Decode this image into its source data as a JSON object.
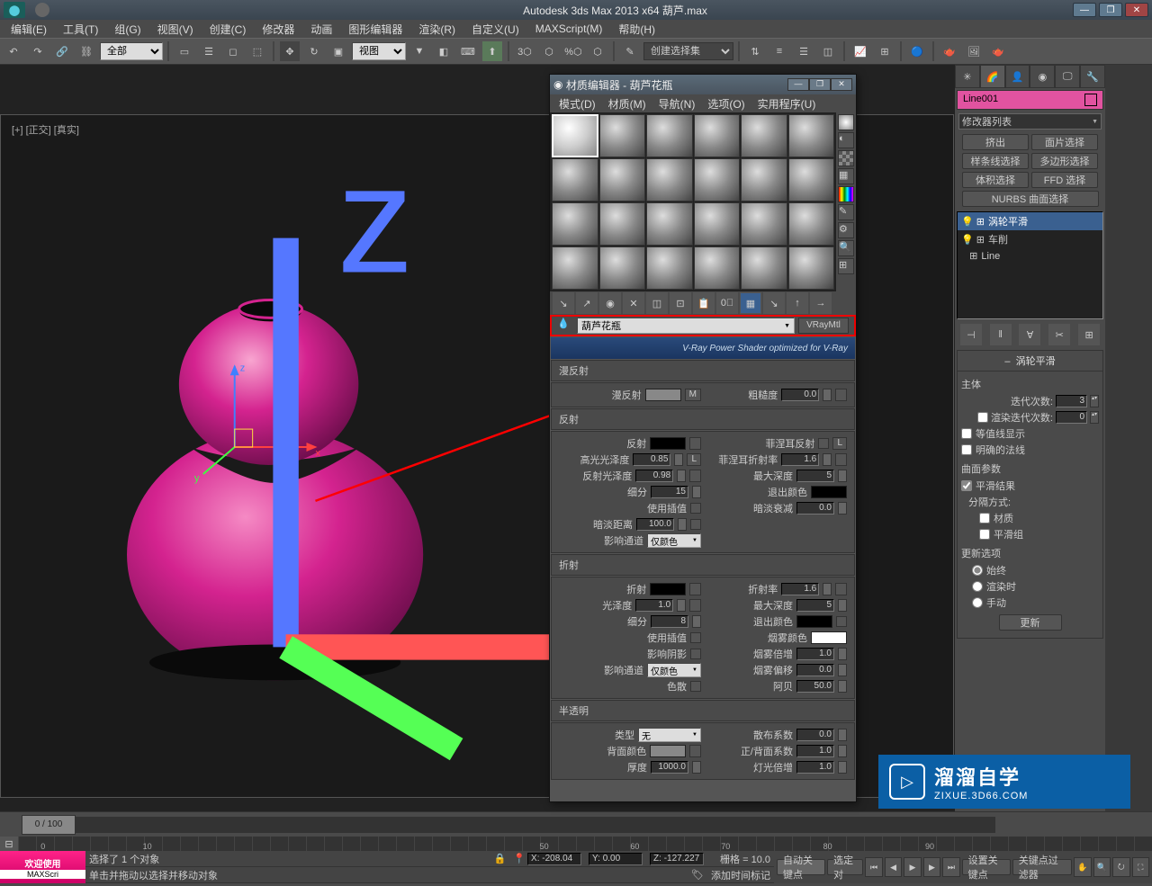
{
  "title": "Autodesk 3ds Max  2013 x64      葫芦.max",
  "menus": [
    "编辑(E)",
    "工具(T)",
    "组(G)",
    "视图(V)",
    "创建(C)",
    "修改器",
    "动画",
    "图形编辑器",
    "渲染(R)",
    "自定义(U)",
    "MAXScript(M)",
    "帮助(H)"
  ],
  "toolbar": {
    "selFilter": "全部",
    "viewMode": "视图",
    "namedSel": "创建选择集"
  },
  "viewport": {
    "label": "[+] [正交] [真实]"
  },
  "timeline": {
    "thumb": "0 / 100"
  },
  "status": {
    "welcome1": "欢迎使用",
    "welcome2": "MAXScri",
    "line1": "选择了 1 个对象",
    "line2": "单击并拖动以选择并移动对象",
    "coordX": "X: -208.04",
    "coordY": "Y: 0.00",
    "coordZ": "Z: -127.227",
    "grid": "栅格 = 10.0",
    "addTimeTag": "添加时间标记",
    "autokey": "自动关键点",
    "selected": "选定对",
    "setkey": "设置关键点",
    "keyfilter": "关键点过滤器"
  },
  "watermark": {
    "cn": "溜溜自学",
    "en": "ZIXUE.3D66.COM"
  },
  "mateditor": {
    "title": "材质编辑器 - 葫芦花瓶",
    "menus": [
      "模式(D)",
      "材质(M)",
      "导航(N)",
      "选项(O)",
      "实用程序(U)"
    ],
    "matName": "葫芦花瓶",
    "matType": "VRayMtl",
    "banner": "V-Ray Power Shader  optimized for V-Ray",
    "rollouts": {
      "diffuse": {
        "head": "漫反射",
        "diffuseLbl": "漫反射",
        "roughnessLbl": "粗糙度",
        "roughness": "0.0",
        "btnM": "M"
      },
      "reflect": {
        "head": "反射",
        "reflectLbl": "反射",
        "hiliteLbl": "高光光泽度",
        "hilite": "0.85",
        "reflGlossLbl": "反射光泽度",
        "reflGloss": "0.98",
        "subdivLbl": "细分",
        "subdiv": "15",
        "useInterpLbl": "使用插值",
        "dimDistLbl": "暗淡距离",
        "dimDist": "100.0",
        "affectLbl": "影响通道",
        "affect": "仅颜色",
        "fresnelLbl": "菲涅耳反射",
        "btnL": "L",
        "fresnelIorLbl": "菲涅耳折射率",
        "fresnelIor": "1.6",
        "maxDepthLbl": "最大深度",
        "maxDepth": "5",
        "exitColorLbl": "退出颜色",
        "dimFallLbl": "暗淡衰减",
        "dimFall": "0.0"
      },
      "refract": {
        "head": "折射",
        "refractLbl": "折射",
        "glossLbl": "光泽度",
        "gloss": "1.0",
        "subdivLbl": "细分",
        "subdiv": "8",
        "useInterpLbl": "使用插值",
        "shadowLbl": "影响阴影",
        "affectLbl": "影响通道",
        "affect": "仅颜色",
        "dispLbl": "色散",
        "iorLbl": "折射率",
        "ior": "1.6",
        "maxDepthLbl": "最大深度",
        "maxDepth": "5",
        "exitColorLbl": "退出颜色",
        "fogColorLbl": "烟雾颜色",
        "fogMultLbl": "烟雾倍增",
        "fogMult": "1.0",
        "fogBiasLbl": "烟雾偏移",
        "fogBias": "0.0",
        "abbeLbl": "阿贝",
        "abbe": "50.0"
      },
      "translucency": {
        "head": "半透明",
        "typeLbl": "类型",
        "type": "无",
        "backColorLbl": "背面颜色",
        "thickLbl": "厚度",
        "thick": "1000.0",
        "scatterLbl": "散布系数",
        "scatter": "0.0",
        "fbLbl": "正/背面系数",
        "fb": "1.0",
        "lightMultLbl": "灯光倍增",
        "lightMult": "1.0"
      }
    }
  },
  "cmd": {
    "objName": "Line001",
    "modListLbl": "修改器列表",
    "btns": {
      "out": "挤出",
      "face": "面片选择",
      "spline": "样条线选择",
      "poly": "多边形选择",
      "vol": "体积选择",
      "ffd": "FFD 选择",
      "nurbs": "NURBS 曲面选择"
    },
    "stack": [
      "涡轮平滑",
      "车削",
      "Line"
    ],
    "turbosmooth": {
      "head": "涡轮平滑",
      "group1": "主体",
      "iterLbl": "迭代次数:",
      "iter": "3",
      "renderIterLbl": "渲染迭代次数:",
      "renderIter": "0",
      "isolineLbl": "等值线显示",
      "explicitLbl": "明确的法线",
      "group2": "曲面参数",
      "smoothLbl": "平滑结果",
      "sepLbl": "分隔方式:",
      "matLbl": "材质",
      "smoothGrpLbl": "平滑组",
      "group3": "更新选项",
      "alwaysLbl": "始终",
      "renderLbl": "渲染时",
      "manualLbl": "手动",
      "updateBtn": "更新"
    }
  }
}
